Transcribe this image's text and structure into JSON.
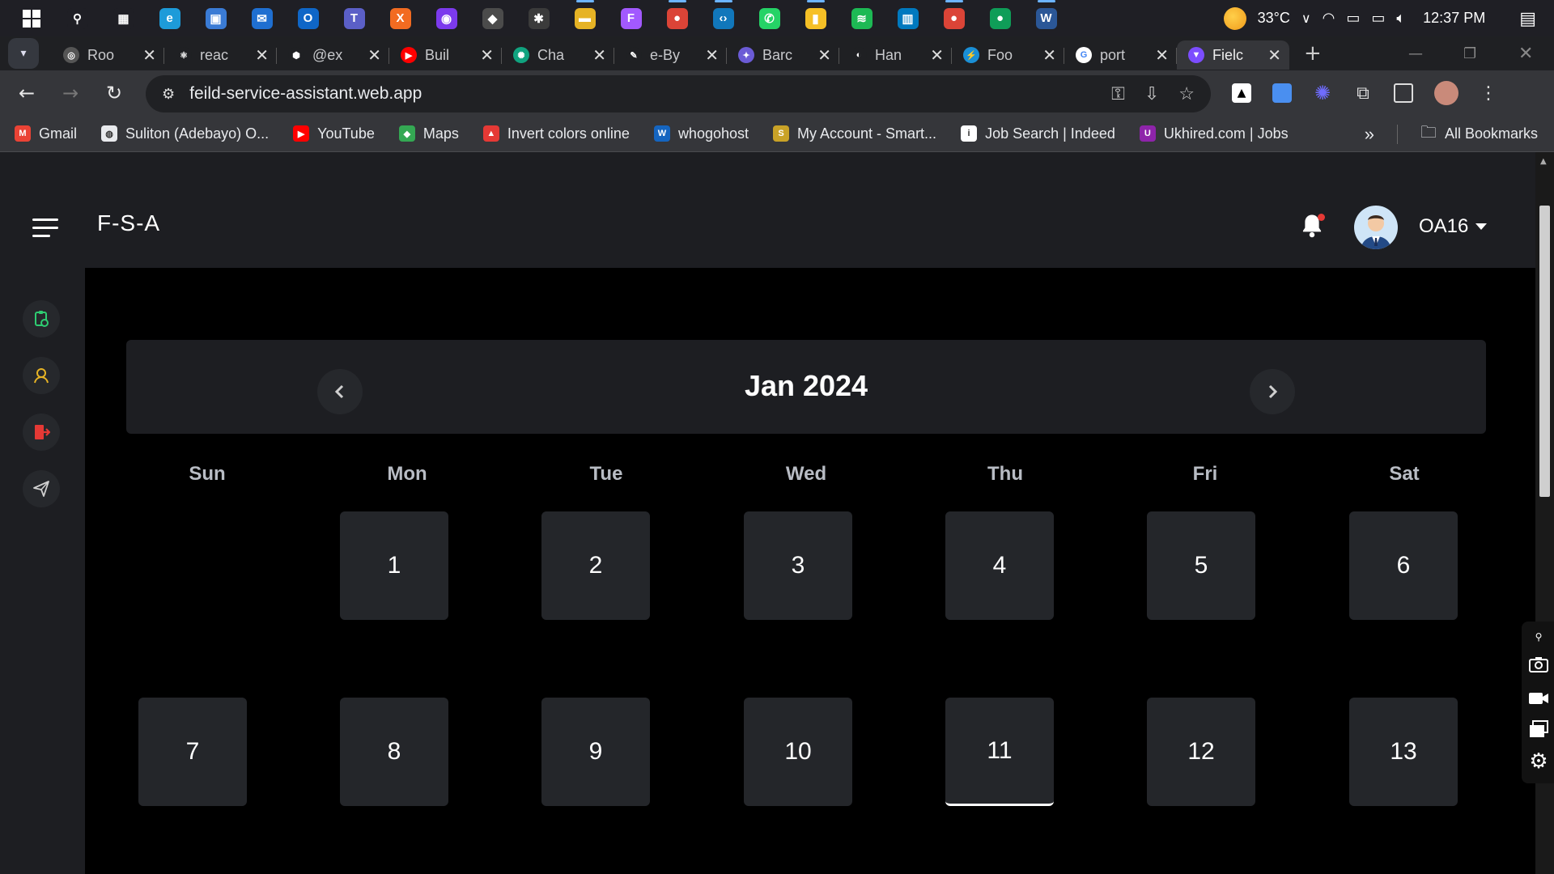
{
  "taskbar": {
    "apps": [
      {
        "name": "search",
        "glyph": "⚲",
        "color": "#1f1f25"
      },
      {
        "name": "task-view",
        "glyph": "▦",
        "color": "#1f1f25"
      },
      {
        "name": "edge",
        "glyph": "e",
        "color": "#1d9bd9"
      },
      {
        "name": "store",
        "glyph": "▣",
        "color": "#3a7bd5"
      },
      {
        "name": "mail",
        "glyph": "✉",
        "color": "#1f6fd1"
      },
      {
        "name": "outlook",
        "glyph": "O",
        "color": "#0f66c7"
      },
      {
        "name": "teams",
        "glyph": "T",
        "color": "#5b5fc7"
      },
      {
        "name": "xampp",
        "glyph": "X",
        "color": "#f26b21"
      },
      {
        "name": "github",
        "glyph": "◉",
        "color": "#7c3aed"
      },
      {
        "name": "git",
        "glyph": "◆",
        "color": "#4b4b4b"
      },
      {
        "name": "slack",
        "glyph": "✱",
        "color": "#3b3b3b"
      },
      {
        "name": "file-explorer",
        "glyph": "▬",
        "color": "#e6b325"
      },
      {
        "name": "figma",
        "glyph": "F",
        "color": "#a259ff"
      },
      {
        "name": "chrome",
        "glyph": "●",
        "color": "#db4437"
      },
      {
        "name": "vscode",
        "glyph": "‹›",
        "color": "#1177bb"
      },
      {
        "name": "whatsapp",
        "glyph": "✆",
        "color": "#25d366"
      },
      {
        "name": "keep",
        "glyph": "▮",
        "color": "#f6c026"
      },
      {
        "name": "spotify",
        "glyph": "≋",
        "color": "#1db954"
      },
      {
        "name": "trello",
        "glyph": "▥",
        "color": "#0079bf"
      },
      {
        "name": "chrome-profile-1",
        "glyph": "●",
        "color": "#db4437"
      },
      {
        "name": "chrome-profile-2",
        "glyph": "●",
        "color": "#0f9d58"
      },
      {
        "name": "word",
        "glyph": "W",
        "color": "#2b5797"
      }
    ],
    "temperature": "33°C",
    "time": "12:37 PM"
  },
  "tabs": [
    {
      "label": "Roo",
      "fav_color": "#555",
      "fav": "◎"
    },
    {
      "label": "reac",
      "fav_color": "#1f2023",
      "fav": "⚛"
    },
    {
      "label": "@ex",
      "fav_color": "#1f2023",
      "fav": "⬢"
    },
    {
      "label": "Buil",
      "fav_color": "#ff0000",
      "fav": "▶"
    },
    {
      "label": "Cha",
      "fav_color": "#10a37f",
      "fav": "✺"
    },
    {
      "label": "e-By",
      "fav_color": "#1f2023",
      "fav": "✎"
    },
    {
      "label": "Barc",
      "fav_color": "#6b5bd6",
      "fav": "✦"
    },
    {
      "label": "Han",
      "fav_color": "#1f2023",
      "fav": "◐"
    },
    {
      "label": "Foo",
      "fav_color": "#1a8fd6",
      "fav": "⚡"
    },
    {
      "label": "port",
      "fav_color": "#ffffff",
      "fav": "G"
    },
    {
      "label": "Fielc",
      "fav_color": "#7c4dff",
      "fav": "▼"
    }
  ],
  "address": {
    "url": "feild-service-assistant.web.app"
  },
  "bookmarks": [
    {
      "label": "Gmail",
      "color": "#ea4335",
      "fav": "M"
    },
    {
      "label": "Suliton (Adebayo) O...",
      "color": "#e8eaed",
      "fav": "◍"
    },
    {
      "label": "YouTube",
      "color": "#ff0000",
      "fav": "▶"
    },
    {
      "label": "Maps",
      "color": "#34a853",
      "fav": "◆"
    },
    {
      "label": "Invert colors online",
      "color": "#e53935",
      "fav": "▲"
    },
    {
      "label": "whogohost",
      "color": "#1565c0",
      "fav": "W"
    },
    {
      "label": "My Account - Smart...",
      "color": "#c9a227",
      "fav": "S"
    },
    {
      "label": "Job Search | Indeed",
      "color": "#ffffff",
      "fav": "i"
    },
    {
      "label": "Ukhired.com | Jobs",
      "color": "#8e24aa",
      "fav": "U"
    }
  ],
  "bookmarks_more": "»",
  "all_bookmarks": "All Bookmarks",
  "app": {
    "brand": "F-S-A",
    "username": "OA16"
  },
  "calendar": {
    "month_label": "Jan 2024",
    "weekdays": [
      "Sun",
      "Mon",
      "Tue",
      "Wed",
      "Thu",
      "Fri",
      "Sat"
    ],
    "week1": [
      "",
      "1",
      "2",
      "3",
      "4",
      "5",
      "6"
    ],
    "week2": [
      "7",
      "8",
      "9",
      "10",
      "11",
      "12",
      "13"
    ],
    "today": "11"
  }
}
